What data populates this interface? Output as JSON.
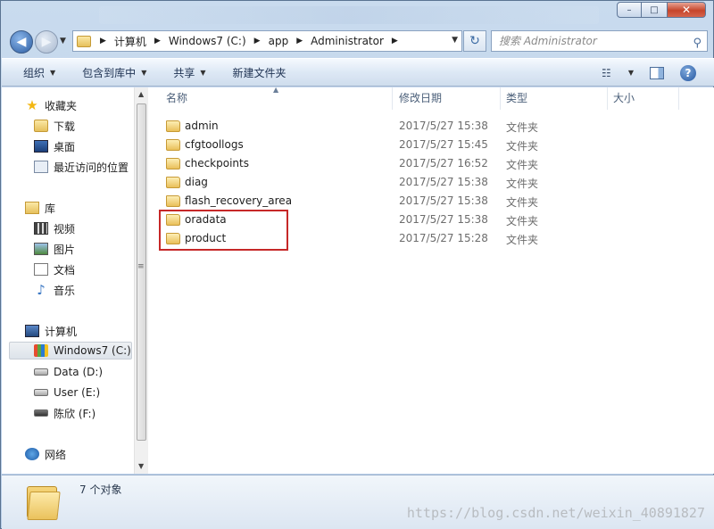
{
  "window": {
    "minimize_icon": "minimize-icon",
    "maximize_icon": "maximize-icon",
    "close_icon": "close-icon",
    "minimize_glyph": "–",
    "maximize_glyph": "□",
    "close_glyph": "✕"
  },
  "nav": {
    "back_glyph": "◀",
    "forward_glyph": "▶",
    "breadcrumbs": [
      "计算机",
      "Windows7 (C:)",
      "app",
      "Administrator"
    ],
    "search_placeholder": "搜索 Administrator",
    "refresh_glyph": "↻"
  },
  "toolbar": {
    "organize": "组织",
    "include_in_library": "包含到库中",
    "share": "共享",
    "new_folder": "新建文件夹",
    "help": "?"
  },
  "sidebar": {
    "favorites": {
      "label": "收藏夹",
      "items": [
        "下载",
        "桌面",
        "最近访问的位置"
      ]
    },
    "libraries": {
      "label": "库",
      "items": [
        "视频",
        "图片",
        "文档",
        "音乐"
      ]
    },
    "computer": {
      "label": "计算机",
      "items": [
        "Windows7 (C:)",
        "Data (D:)",
        "User (E:)",
        "陈欣 (F:)"
      ],
      "selected_index": 0
    },
    "network": {
      "label": "网络"
    }
  },
  "columns": [
    "名称",
    "修改日期",
    "类型",
    "大小"
  ],
  "files": [
    {
      "name": "admin",
      "modified": "2017/5/27 15:38",
      "type": "文件夹"
    },
    {
      "name": "cfgtoollogs",
      "modified": "2017/5/27 15:45",
      "type": "文件夹"
    },
    {
      "name": "checkpoints",
      "modified": "2017/5/27 16:52",
      "type": "文件夹"
    },
    {
      "name": "diag",
      "modified": "2017/5/27 15:38",
      "type": "文件夹"
    },
    {
      "name": "flash_recovery_area",
      "modified": "2017/5/27 15:38",
      "type": "文件夹"
    },
    {
      "name": "oradata",
      "modified": "2017/5/27 15:38",
      "type": "文件夹"
    },
    {
      "name": "product",
      "modified": "2017/5/27 15:28",
      "type": "文件夹"
    }
  ],
  "annotation": {
    "highlighted_items": [
      "oradata",
      "product"
    ],
    "color": "#c62828"
  },
  "status": {
    "item_count": "7 个对象"
  },
  "watermark": "https://blog.csdn.net/weixin_40891827"
}
